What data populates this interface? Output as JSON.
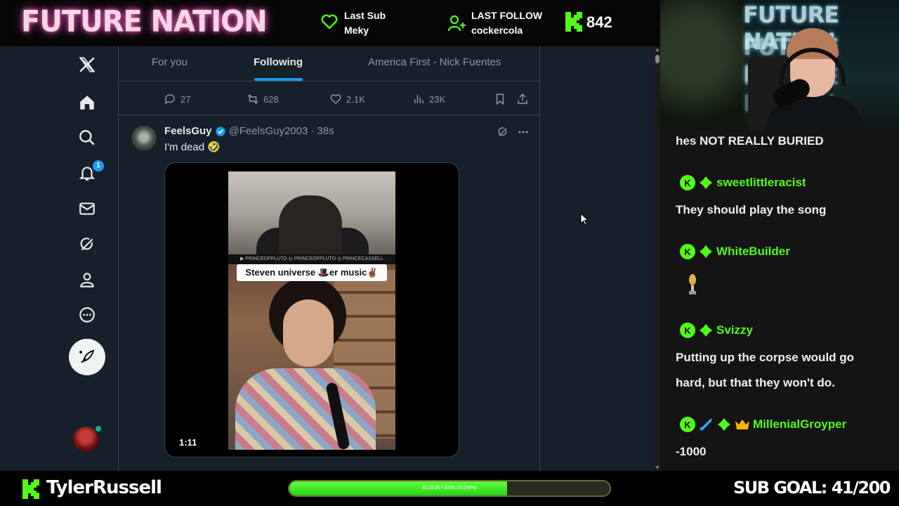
{
  "overlay": {
    "brand": "FUTURE NATION",
    "last_sub": {
      "label": "Last Sub",
      "name": "Meky"
    },
    "last_follow": {
      "label": "LAST FOLLOW",
      "name": "cockercola"
    },
    "kick_count": "842",
    "channel_name": "TylerRussell",
    "sub_goal": "SUB GOAL: 41/200",
    "goal_bar_text": "$133.00 / $200.00 (68%)",
    "goal_progress_percent": 68,
    "accent_color": "#53fc18"
  },
  "x": {
    "nav": {
      "icons": [
        "x-logo-icon",
        "home-icon",
        "search-icon",
        "bell-icon",
        "mail-icon",
        "grok-icon",
        "profile-icon",
        "more-circle-icon",
        "compose-icon"
      ],
      "notification_badge": "1"
    },
    "tabs": [
      {
        "label": "For you"
      },
      {
        "label": "Following",
        "active": true
      },
      {
        "label": "America First - Nick Fuentes"
      }
    ],
    "prev_post_actions": {
      "replies": "27",
      "reposts": "628",
      "likes": "2.1K",
      "views": "23K"
    },
    "post": {
      "name": "FeelsGuy",
      "handle": "@FeelsGuy2003",
      "time": "· 38s",
      "text": "I'm dead 🤣",
      "video_caption": "Steven universe 🎩er music✌🏾",
      "video_strip": "▶ PRINCEOFPLUTO  ◎ PRINCEOFPLUTO  ◎ PRINCECASSELL",
      "duration": "1:11"
    }
  },
  "chat": {
    "messages": [
      {
        "user": "",
        "text": "hes NOT REALLY BURIED"
      },
      {
        "user": "sweetlittleracist",
        "text": "They should play the song"
      },
      {
        "user": "WhiteBuilder",
        "text": ""
      },
      {
        "user": "Svizzy",
        "text": "Putting up the corpse would go hard, but that they won't do."
      },
      {
        "user": "MillenialGroyper",
        "text": "-1000"
      }
    ]
  },
  "webcam": {
    "sign_line": "FUTURE NATION"
  }
}
